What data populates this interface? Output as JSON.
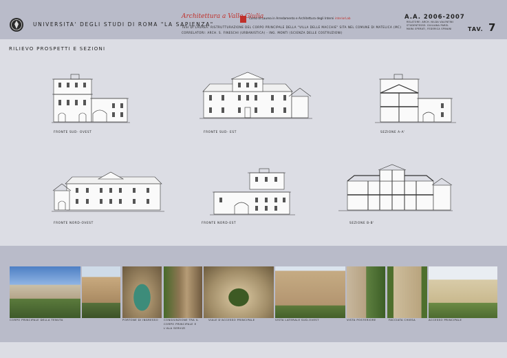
{
  "header": {
    "university": "UNIVERSITA' DEGLI STUDI DI ROMA \"LA SAPIENZA\"",
    "brand": "Architettura a Valle Giulia",
    "corso_prefix": "Corso di Laurea in Arredamento e Architettura degli Interni",
    "corso_highlight": "interiorLab",
    "tesi": "TESI DI LAUREA: RISTRUTTURAZIONE DEL CORPO PRINCIPALE DELLA \"VILLA DELLE MACCHIE\" SITA NEL COMUNE DI MATELICA (MC)",
    "relatori": "CORRELATORI: ARCH. S. FINESCHI (URBANISTICA) - ING. MONTI (SCIENZA DELLE COSTRUZIONI)",
    "academic_year": "A.A. 2006-2007",
    "credits": [
      "RELATORE: ARCH. NILDA VALENTINI",
      "STUDENTESSE: GIULIANA PAREL",
      "MARA SPERATI, FEDERICA SPINANI"
    ],
    "tav_label": "TAV.",
    "tav_number": "7"
  },
  "subtitle": "RILIEVO PROSPETTI E SEZIONI",
  "drawings": [
    {
      "caption": "FRONTE SUD- OVEST"
    },
    {
      "caption": "FRONTE SUD- EST"
    },
    {
      "caption": "SEZIONE A-A'"
    },
    {
      "caption": "FRONTE NORD-OVEST"
    },
    {
      "caption": "FRONTE NORD-EST"
    },
    {
      "caption": "SEZIONE B-B'"
    }
  ],
  "photos": [
    {
      "caption": "CORPO PRINCIPALE DELLA TENUTA"
    },
    {
      "caption": ""
    },
    {
      "caption": "PORTONE DI INGRESSO"
    },
    {
      "caption": "CONGIUNZIONE TRA IL CORPO PRINCIPALE E L'ALA SERVIZI"
    },
    {
      "caption": "VIALE D'ACCESSO PRINCIPALE"
    },
    {
      "caption": "VISTA LATERALE SUD-OVEST"
    },
    {
      "caption": "VISTA POSTERIORE"
    },
    {
      "caption": "FACCIATA CHIESA"
    },
    {
      "caption": "ACCESSO PRINCIPALE"
    }
  ],
  "colors": {
    "header_band": "#b9bbc9",
    "page": "#dcdde4",
    "accent": "#c0302a"
  }
}
